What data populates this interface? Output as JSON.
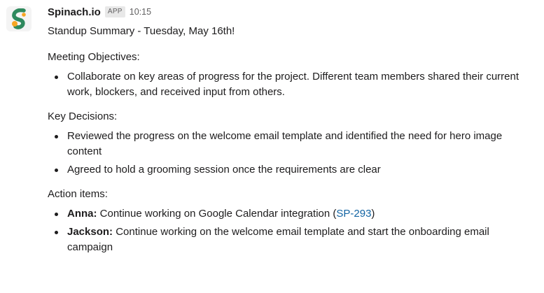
{
  "message": {
    "sender": "Spinach.io",
    "app_badge": "APP",
    "timestamp": "10:15",
    "summary_title": "Standup Summary - Tuesday, May 16th!",
    "sections": {
      "objectives": {
        "heading": "Meeting Objectives:",
        "items": [
          "Collaborate on key areas of progress for the project. Different team members shared their current work, blockers, and received input from others."
        ]
      },
      "decisions": {
        "heading": "Key Decisions:",
        "items": [
          "Reviewed the progress on the welcome email template and identified the need for hero image content",
          "Agreed to hold a grooming session once the requirements are clear"
        ]
      },
      "actions": {
        "heading": "Action items:",
        "items": [
          {
            "name": "Anna:",
            "text": " Continue working on Google Calendar integration (",
            "link": "SP-293",
            "suffix": ")"
          },
          {
            "name": "Jackson:",
            "text": " Continue working on the welcome email template and start the onboarding email campaign"
          }
        ]
      }
    }
  },
  "colors": {
    "logo_green": "#2f8a5e",
    "logo_orange": "#f6a623",
    "link": "#1264a3"
  },
  "icons": {
    "avatar": "spinach-logo-icon"
  }
}
